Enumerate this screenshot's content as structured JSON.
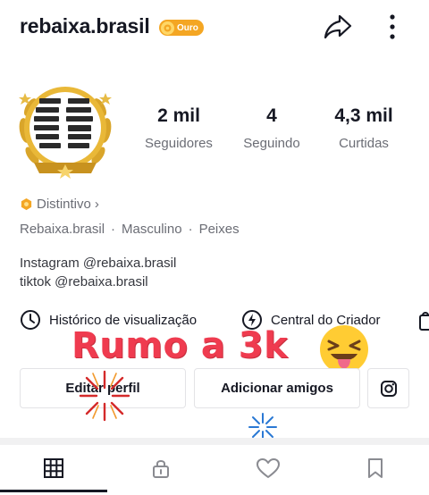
{
  "header": {
    "username": "rebaixa.brasil",
    "badge_label": "Ouro"
  },
  "stats": [
    {
      "value": "2 mil",
      "label": "Seguidores"
    },
    {
      "value": "4",
      "label": "Seguindo"
    },
    {
      "value": "4,3 mil",
      "label": "Curtidas"
    }
  ],
  "distintivo": {
    "label": "Distintivo",
    "chevron": "›"
  },
  "tags": [
    "Rebaixa.brasil",
    "Masculino",
    "Peixes"
  ],
  "tag_separator": "·",
  "bio": [
    "Instagram @rebaixa.brasil",
    "tiktok @rebaixa.brasil"
  ],
  "shortcuts": {
    "history_label": "Histórico de visualização",
    "creator_label": "Central do Criador"
  },
  "overlay_text": "Rumo a 3k",
  "buttons": {
    "edit_profile": "Editar perfil",
    "add_friends": "Adicionar amigos"
  },
  "icons": {
    "share": "share-arrow-icon",
    "more": "vertical-dots-icon",
    "instagram": "instagram-icon",
    "grid": "grid-icon",
    "lock": "lock-icon",
    "heart": "heart-icon",
    "bookmark": "bookmark-icon"
  },
  "colors": {
    "badge": "#f4a623",
    "overlay_text": "#ef3b4f",
    "text_primary": "#161823",
    "text_secondary": "#6b6d75"
  }
}
